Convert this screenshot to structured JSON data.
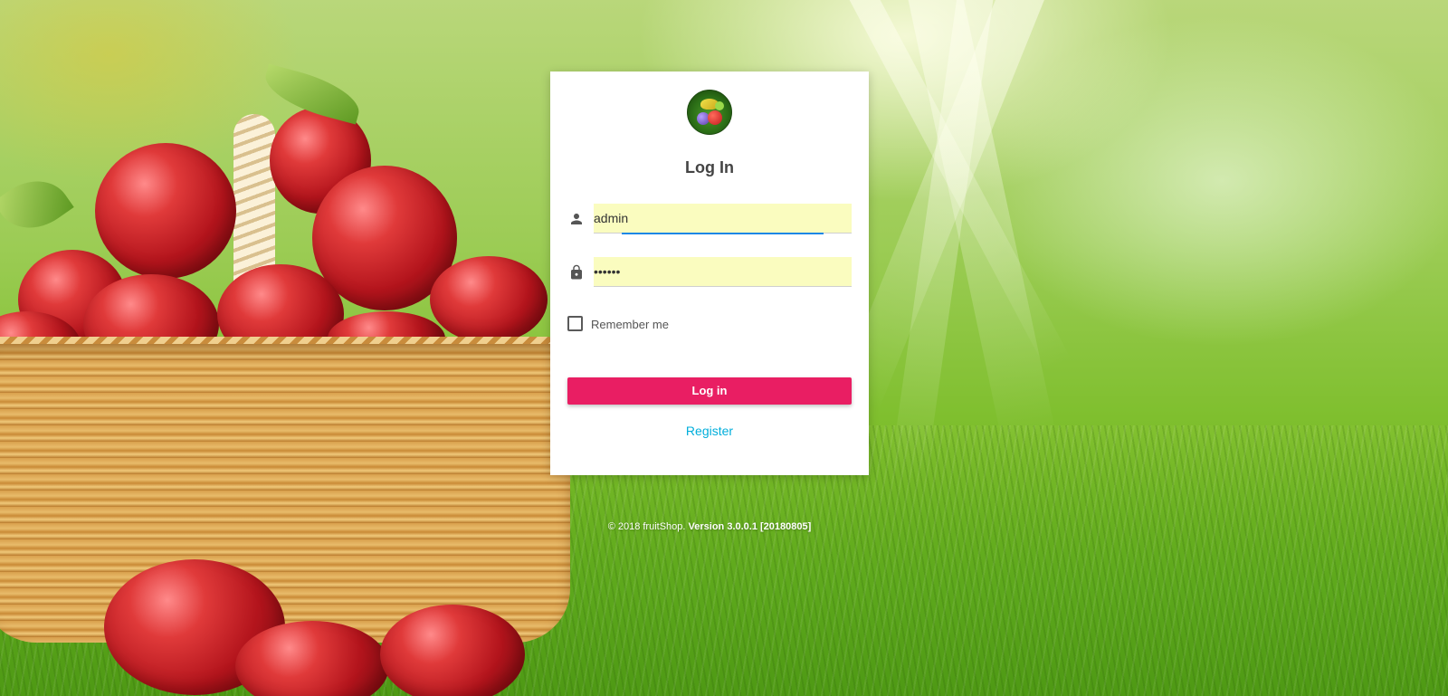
{
  "login": {
    "title": "Log In",
    "username": {
      "value": "admin",
      "icon": "person-icon"
    },
    "password": {
      "masked_value": "••••••",
      "icon": "lock-icon"
    },
    "remember_label": "Remember me",
    "login_button": "Log in",
    "register_link": "Register"
  },
  "footer": {
    "copyright": "© 2018 fruitShop.",
    "version": "Version 3.0.0.1 [20180805]"
  },
  "colors": {
    "primary_button": "#e91e63",
    "link": "#00aedb",
    "input_autofill_bg": "#fafcbf",
    "focus_underline": "#1e88e5"
  }
}
